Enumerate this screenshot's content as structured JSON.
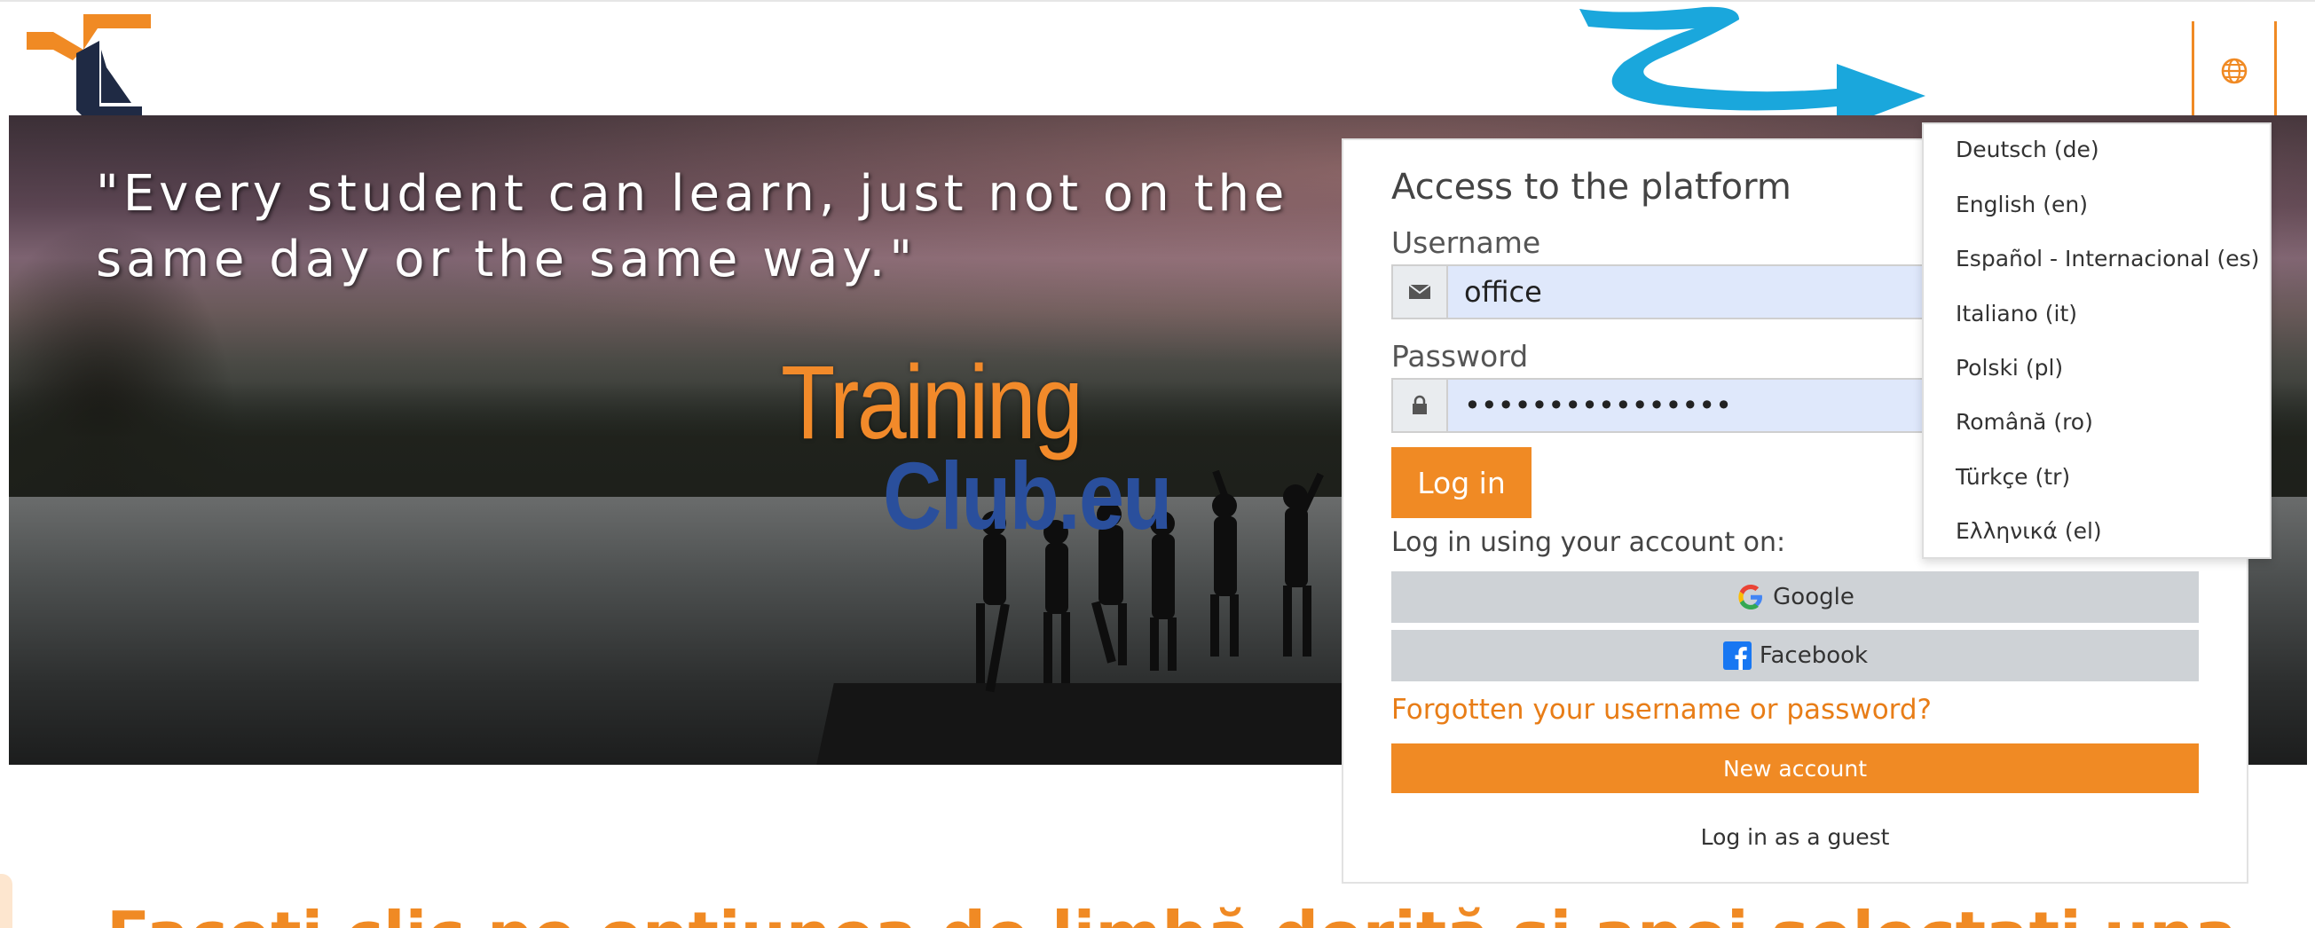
{
  "header": {
    "logo_icon": "tc-logo-icon",
    "language_icon": "globe-icon"
  },
  "hero": {
    "quote": "\"Every student can learn, just not on the same day or the same way.\"",
    "brand_line1": "Training",
    "brand_line2": "Club.eu"
  },
  "login": {
    "title": "Access to the platform",
    "username_label": "Username",
    "username_value": "office",
    "username_icon": "envelope-icon",
    "password_label": "Password",
    "password_value": "••••••••••••••••",
    "password_icon": "lock-icon",
    "login_button": "Log in",
    "using_label": "Log in using your account on:",
    "google_label": "Google",
    "facebook_label": "Facebook",
    "forgot_link": "Forgotten your username or password?",
    "new_account": "New account",
    "guest": "Log in as a guest"
  },
  "language_menu": {
    "options": [
      "Deutsch (de)",
      "English (en)",
      "Español - Internacional (es)",
      "Italiano (it)",
      "Polski (pl)",
      "Română (ro)",
      "Türkçe (tr)",
      "Ελληνικά (el)"
    ]
  },
  "bottom": {
    "heading": "Faceți clic pe opțiunea de limbă dorită și apoi selectați una"
  },
  "colors": {
    "accent": "#f08a24",
    "arrow": "#1aa7dc",
    "brand_blue": "#2a4f9c"
  }
}
